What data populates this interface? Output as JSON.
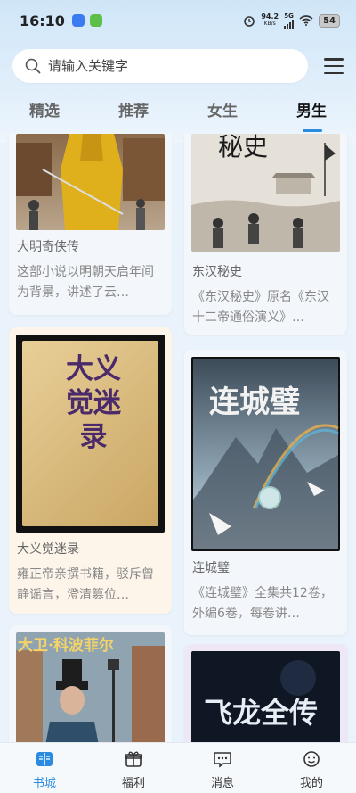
{
  "status": {
    "time": "16:10",
    "net_speed_value": "94.2",
    "net_speed_unit": "KB/s",
    "network": "5G",
    "battery": "54"
  },
  "search": {
    "placeholder": "请输入关键字"
  },
  "tabs": [
    {
      "label": "精选",
      "active": false
    },
    {
      "label": "推荐",
      "active": false
    },
    {
      "label": "女生",
      "active": false
    },
    {
      "label": "男生",
      "active": true
    }
  ],
  "books": [
    {
      "title": "大明奇侠传",
      "desc": "这部小说以明朝天启年间为背景，讲述了云…"
    },
    {
      "title": "东汉秘史",
      "desc": "《东汉秘史》原名《东汉十二帝通俗演义》…",
      "cover_text": "秘史"
    },
    {
      "title": "大义觉迷录",
      "desc": "雍正帝亲撰书籍，驳斥曾静谣言，澄清篡位…",
      "cover_text": "大义觉迷录"
    },
    {
      "title": "连城璧",
      "desc": "《连城璧》全集共12卷，外编6卷，每卷讲…",
      "cover_text": "连城璧"
    },
    {
      "title": "",
      "desc": "",
      "cover_text": "大卫·科波菲尔"
    },
    {
      "title": "",
      "desc": "",
      "cover_text": "飞龙全传"
    }
  ],
  "nav": [
    {
      "label": "书城",
      "icon": "book-icon",
      "active": true
    },
    {
      "label": "福利",
      "icon": "gift-icon",
      "active": false
    },
    {
      "label": "消息",
      "icon": "message-icon",
      "active": false
    },
    {
      "label": "我的",
      "icon": "profile-icon",
      "active": false
    }
  ],
  "colors": {
    "accent": "#2a8be0",
    "background": "#eaf3fb"
  }
}
